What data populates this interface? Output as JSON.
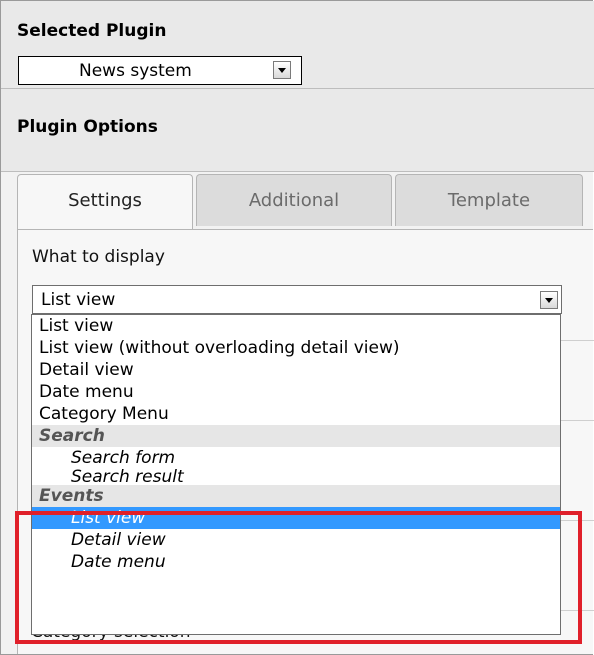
{
  "selected_plugin": {
    "header": "Selected Plugin",
    "value": "News system"
  },
  "plugin_options": {
    "header": "Plugin Options"
  },
  "tabs": [
    {
      "label": "Settings",
      "active": true
    },
    {
      "label": "Additional",
      "active": false
    },
    {
      "label": "Template",
      "active": false
    }
  ],
  "what_to_display": {
    "label": "What to display",
    "value": "List view",
    "options": [
      {
        "label": "List view",
        "type": "option"
      },
      {
        "label": "List view (without overloading detail view)",
        "type": "option"
      },
      {
        "label": "Detail view",
        "type": "option"
      },
      {
        "label": "Date menu",
        "type": "option"
      },
      {
        "label": "Category Menu",
        "type": "option"
      },
      {
        "label": "Search",
        "type": "group"
      },
      {
        "label": "Search form",
        "type": "sub"
      },
      {
        "label": "Search result",
        "type": "sub"
      },
      {
        "label": "Events",
        "type": "group"
      },
      {
        "label": "List view",
        "type": "sub",
        "selected": true
      },
      {
        "label": "Detail view",
        "type": "sub"
      },
      {
        "label": "Date menu",
        "type": "sub"
      }
    ]
  },
  "behind_label": "Category selection",
  "colors": {
    "selection": "#3399ff",
    "highlight": "#e0202a",
    "header_bg": "#e9e9e9"
  }
}
